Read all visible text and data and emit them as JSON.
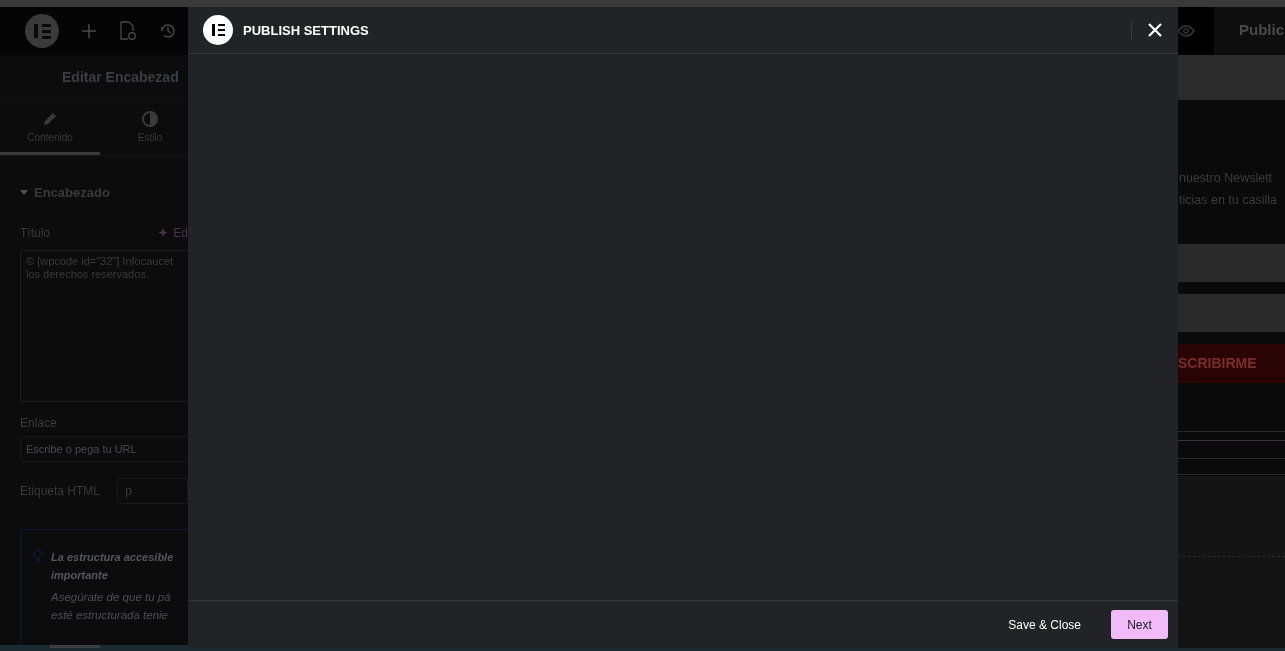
{
  "editor_panel": {
    "title": "Editar Encabezad",
    "tabs": [
      {
        "label": "Contenido",
        "selected": true
      },
      {
        "label": "Estilo",
        "selected": false
      }
    ],
    "section": {
      "title": "Encabezado",
      "expanded": true
    },
    "title_field": {
      "label": "Título",
      "ai_button": "Ed",
      "lines": [
        "© [wpcode id=\"32\"] Infocaucet",
        "los derechos reservados."
      ]
    },
    "link_field": {
      "label": "Enlace",
      "placeholder": "Escribe o pega tu URL"
    },
    "html_tag": {
      "label": "Etiqueta HTML",
      "value": "p"
    },
    "notice": {
      "title_lines": [
        "La estructura accesible",
        "importante"
      ],
      "body_lines": [
        "Asegúrate de que tu pá",
        "esté estructurada tenie"
      ]
    }
  },
  "preview": {
    "publish_button": "Public",
    "text_lines": [
      "nuestro Newslett",
      "ticias en tu casilla"
    ],
    "subscribe_button": "SCRIBIRME"
  },
  "modal": {
    "title": "PUBLISH SETTINGS",
    "buttons": [
      {
        "label": "Save & Close",
        "kind": "secondary"
      },
      {
        "label": "Next",
        "kind": "primary"
      }
    ]
  }
}
